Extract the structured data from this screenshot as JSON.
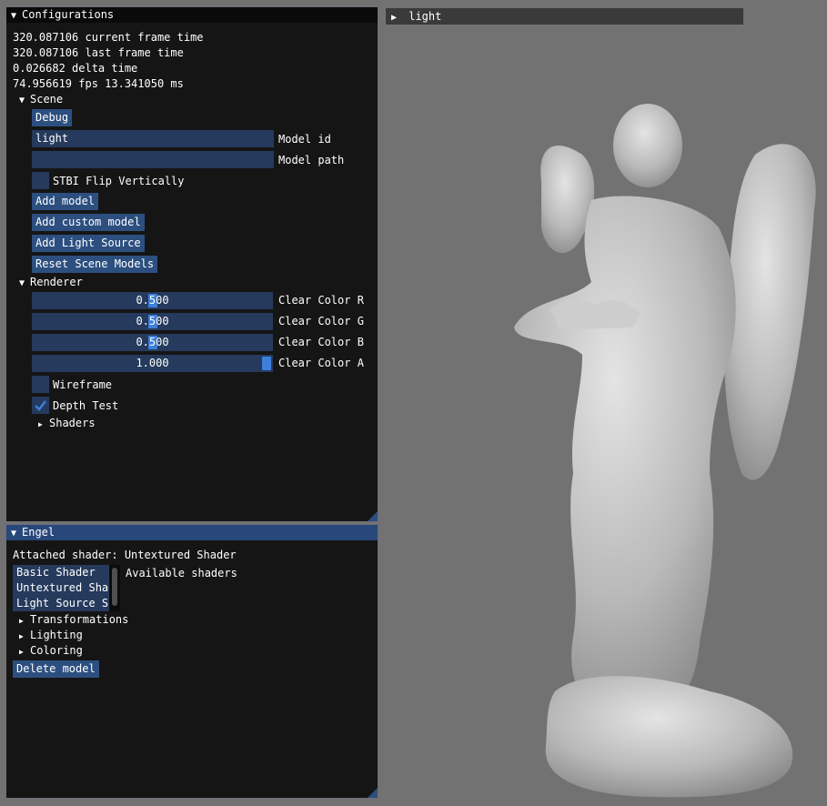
{
  "viewport_bg": "#727272",
  "light_window": {
    "title": "light"
  },
  "config_window": {
    "title": "Configurations",
    "stats": [
      "320.087106 current frame time",
      "320.087106 last frame time",
      "0.026682 delta time",
      "74.956619 fps 13.341050 ms"
    ],
    "scene": {
      "header": "Scene",
      "debug_label": "Debug",
      "model_id_value": "light",
      "model_id_label": "Model id",
      "model_path_value": "",
      "model_path_label": "Model path",
      "stbi_label": "STBI Flip Vertically",
      "stbi_checked": false,
      "add_model": "Add model",
      "add_custom_model": "Add custom model",
      "add_light_source": "Add Light Source",
      "reset_scene": "Reset Scene Models"
    },
    "renderer": {
      "header": "Renderer",
      "sliders": [
        {
          "value": "0.500",
          "label": "Clear Color R",
          "fraction": 0.5
        },
        {
          "value": "0.500",
          "label": "Clear Color G",
          "fraction": 0.5
        },
        {
          "value": "0.500",
          "label": "Clear Color B",
          "fraction": 0.5
        },
        {
          "value": "1.000",
          "label": "Clear Color A",
          "fraction": 1.0
        }
      ],
      "wireframe_label": "Wireframe",
      "wireframe_checked": false,
      "depth_test_label": "Depth Test",
      "depth_test_checked": true,
      "shaders_label": "Shaders"
    }
  },
  "engel_window": {
    "title": "Engel",
    "attached": "Attached shader: Untextured Shader",
    "shader_list": [
      "Basic Shader",
      "Untextured Shader",
      "Light Source Shader"
    ],
    "available_label": "Available shaders",
    "transformations": "Transformations",
    "lighting": "Lighting",
    "coloring": "Coloring",
    "delete_model": "Delete model"
  },
  "icons": {
    "expanded": "triangle-down-icon",
    "collapsed": "triangle-right-icon",
    "check": "check-icon"
  },
  "colors": {
    "title_active": "#28477a",
    "frame_bg": "#253a5c",
    "button": "#2c4f80",
    "accent": "#3d7fdb",
    "window_bg": "#151515"
  }
}
